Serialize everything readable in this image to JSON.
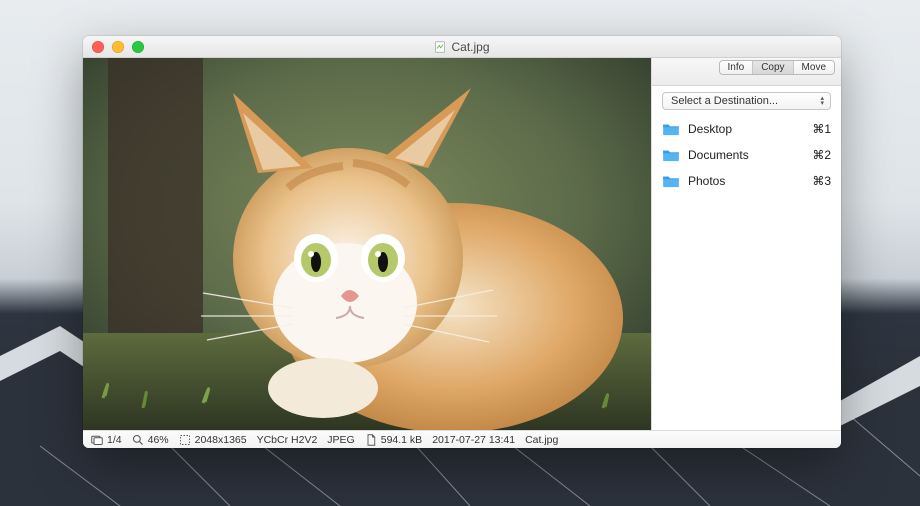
{
  "window": {
    "title": "Cat.jpg"
  },
  "sidebar": {
    "tabs": {
      "info": "Info",
      "copy": "Copy",
      "move": "Move",
      "active": "Copy"
    },
    "dropdown_label": "Select a Destination...",
    "items": [
      {
        "label": "Desktop",
        "shortcut": "⌘1"
      },
      {
        "label": "Documents",
        "shortcut": "⌘2"
      },
      {
        "label": "Photos",
        "shortcut": "⌘3"
      }
    ]
  },
  "status": {
    "index": "1/4",
    "zoom": "46%",
    "dimensions": "2048x1365",
    "color": "YCbCr H2V2",
    "format": "JPEG",
    "size": "594.1 kB",
    "datetime": "2017-07-27 13:41",
    "filename": "Cat.jpg"
  }
}
